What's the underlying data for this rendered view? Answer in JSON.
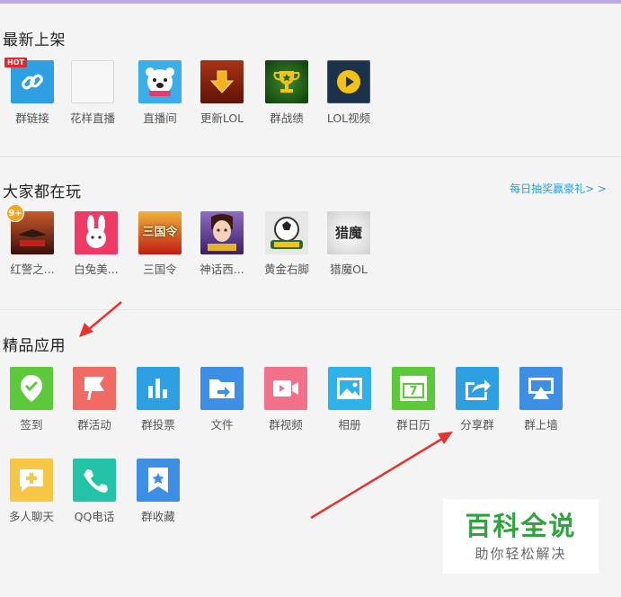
{
  "sections": {
    "new_arrivals": {
      "title": "最新上架",
      "apps": [
        {
          "label": "群链接",
          "icon": "link-icon",
          "color": "#2e9fe0",
          "badge": "HOT"
        },
        {
          "label": "花样直播",
          "icon": "blank-icon",
          "color": "#f7f7f7"
        },
        {
          "label": "直播间",
          "icon": "polar-bear-icon",
          "color": "#3aaee8"
        },
        {
          "label": "更新LOL",
          "icon": "download-arrow-icon",
          "color": "#8b2412"
        },
        {
          "label": "群战绩",
          "icon": "trophy-icon",
          "color": "#1d6a1a"
        },
        {
          "label": "LOL视频",
          "icon": "play-icon",
          "color": "#1b3248"
        }
      ]
    },
    "popular": {
      "title": "大家都在玩",
      "promo_link": "每日抽奖赢豪礼> >",
      "apps": [
        {
          "label": "红警之...",
          "icon": "red-alert-game-icon",
          "color": "#6b1f12",
          "badge": "9+"
        },
        {
          "label": "白兔美...",
          "icon": "white-rabbit-game-icon",
          "color": "#ef3a66"
        },
        {
          "label": "三国令",
          "icon": "three-kingdoms-game-icon",
          "color": "#d7261e",
          "text": "三国令"
        },
        {
          "label": "神话西...",
          "icon": "myth-west-game-icon",
          "color": "#5c3a8e"
        },
        {
          "label": "黄金右脚",
          "icon": "golden-foot-game-icon",
          "color": "#2f6b2a"
        },
        {
          "label": "猎魔OL",
          "icon": "hunter-ol-game-icon",
          "color": "#e8e8e8",
          "text": "猎魔"
        }
      ]
    },
    "featured": {
      "title": "精品应用",
      "apps": [
        {
          "label": "签到",
          "icon": "check-in-icon",
          "color": "#5cc93b"
        },
        {
          "label": "群活动",
          "icon": "flag-icon",
          "color": "#f06b63"
        },
        {
          "label": "群投票",
          "icon": "bar-chart-icon",
          "color": "#2e9fe0"
        },
        {
          "label": "文件",
          "icon": "folder-icon",
          "color": "#3d8fe6"
        },
        {
          "label": "群视频",
          "icon": "video-icon",
          "color": "#f1718b"
        },
        {
          "label": "相册",
          "icon": "photo-icon",
          "color": "#2eb2e8"
        },
        {
          "label": "群日历",
          "icon": "calendar-icon",
          "color": "#5cc93b",
          "text": "7"
        },
        {
          "label": "分享群",
          "icon": "share-icon",
          "color": "#2e9fe0"
        },
        {
          "label": "群上墙",
          "icon": "screen-cast-icon",
          "color": "#3d8fe6"
        },
        {
          "label": "多人聊天",
          "icon": "chat-plus-icon",
          "color": "#f7c644"
        },
        {
          "label": "QQ电话",
          "icon": "phone-icon",
          "color": "#22c3a6"
        },
        {
          "label": "群收藏",
          "icon": "bookmark-star-icon",
          "color": "#3d8fe6"
        }
      ]
    }
  },
  "watermark": {
    "title": "百科全说",
    "subtitle": "助你轻松解决"
  },
  "annotation_color": "#e8332d"
}
